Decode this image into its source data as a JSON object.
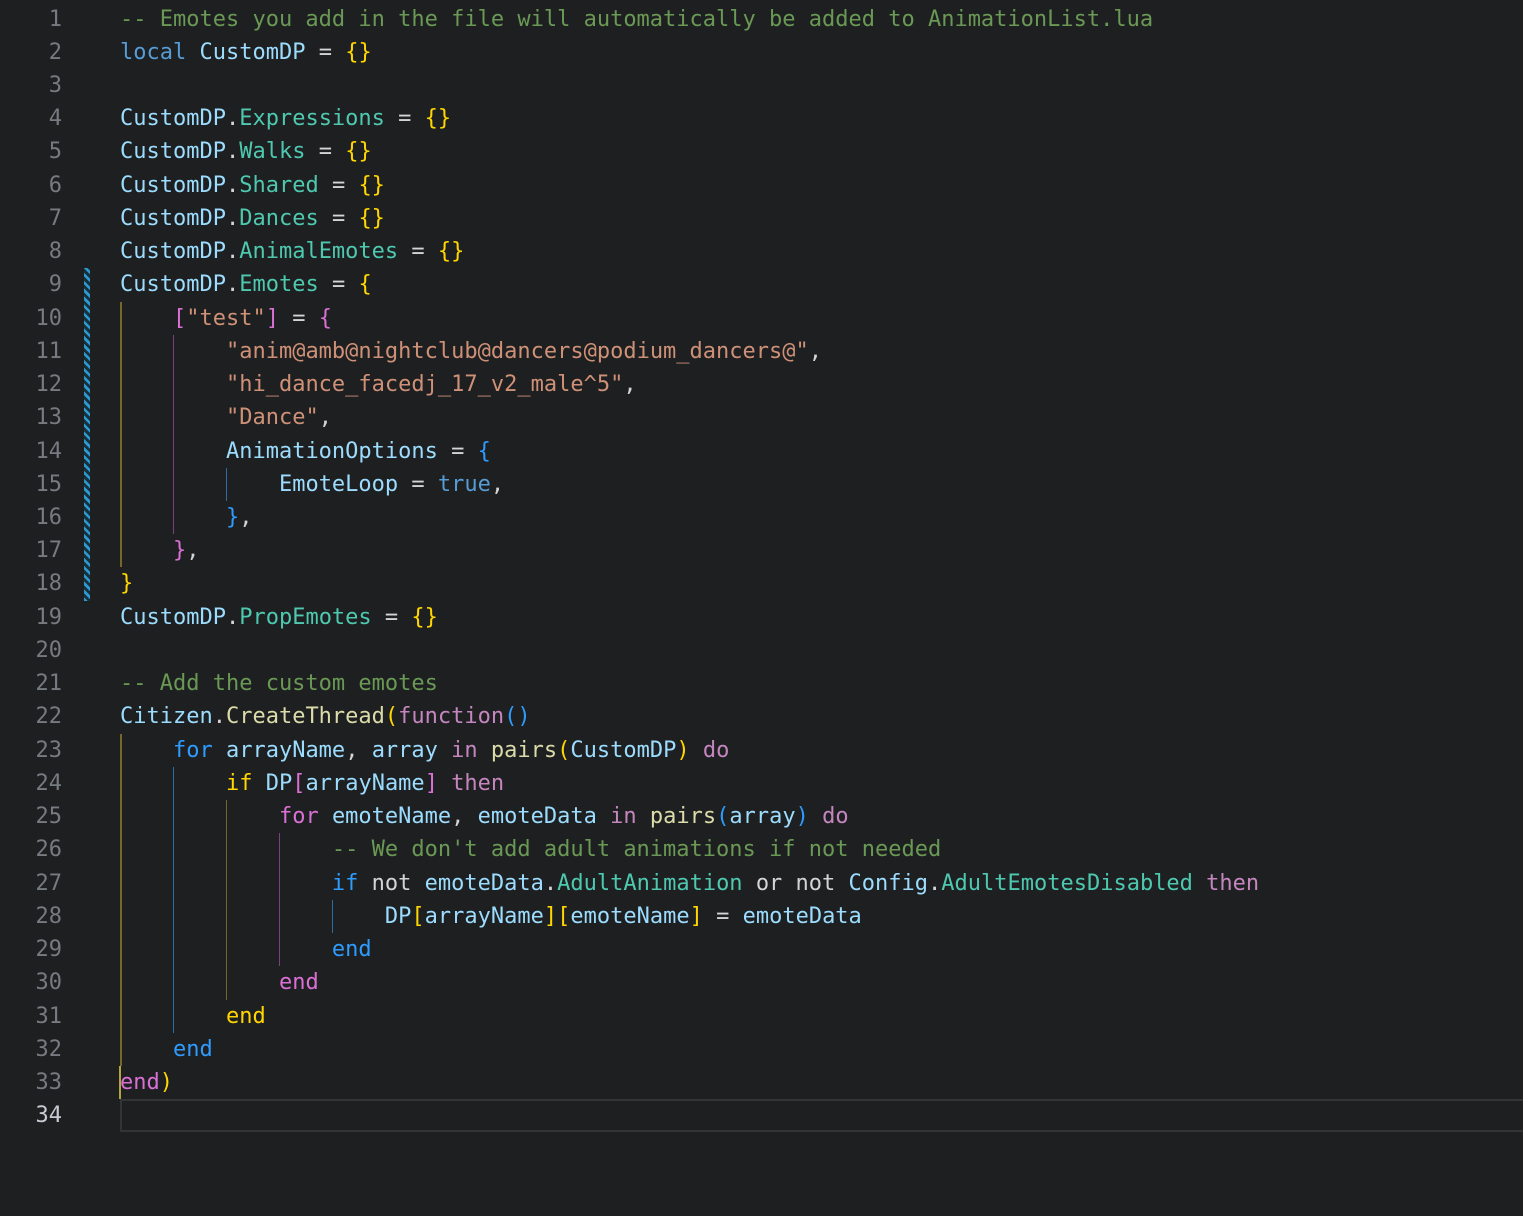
{
  "editor": {
    "title": "AnimationList custom emotes Lua source",
    "language": "lua",
    "background": "#1e1f20",
    "palette": {
      "comment": "#6A9955",
      "keywordBlue": "#569CD6",
      "keywordPink": "#C586C0",
      "variable": "#9CDCFE",
      "property": "#4EC9B0",
      "function": "#DCDCAA",
      "string": "#CE9178",
      "punct": "#D4D4D4",
      "gold": "#FFD602",
      "orchid": "#DA70D6",
      "blue": "#2E9CFF",
      "guideGold": "#77672b",
      "guideOrchid": "#7c4080",
      "guideBlue": "#2c6ca3",
      "lineNumber": "#757b80",
      "lineNumberActive": "#c6ccd2",
      "gitModifiedStripe": "#2e9ad0",
      "caret": "#b3a544",
      "currentLineBorder": "#323536"
    },
    "lines": [
      {
        "n": 1,
        "tokens": [
          [
            "-- Emotes you add in the file will automatically be added to AnimationList.lua",
            "comment"
          ]
        ]
      },
      {
        "n": 2,
        "tokens": [
          [
            "local ",
            "keywordBlue"
          ],
          [
            "CustomDP ",
            "variable"
          ],
          [
            "= ",
            "punct"
          ],
          [
            "{}",
            "gold"
          ]
        ]
      },
      {
        "n": 3,
        "tokens": []
      },
      {
        "n": 4,
        "tokens": [
          [
            "CustomDP",
            "variable"
          ],
          [
            ".",
            "punct"
          ],
          [
            "Expressions ",
            "property"
          ],
          [
            "= ",
            "punct"
          ],
          [
            "{}",
            "gold"
          ]
        ]
      },
      {
        "n": 5,
        "tokens": [
          [
            "CustomDP",
            "variable"
          ],
          [
            ".",
            "punct"
          ],
          [
            "Walks ",
            "property"
          ],
          [
            "= ",
            "punct"
          ],
          [
            "{}",
            "gold"
          ]
        ]
      },
      {
        "n": 6,
        "tokens": [
          [
            "CustomDP",
            "variable"
          ],
          [
            ".",
            "punct"
          ],
          [
            "Shared ",
            "property"
          ],
          [
            "= ",
            "punct"
          ],
          [
            "{}",
            "gold"
          ]
        ]
      },
      {
        "n": 7,
        "tokens": [
          [
            "CustomDP",
            "variable"
          ],
          [
            ".",
            "punct"
          ],
          [
            "Dances ",
            "property"
          ],
          [
            "= ",
            "punct"
          ],
          [
            "{}",
            "gold"
          ]
        ]
      },
      {
        "n": 8,
        "tokens": [
          [
            "CustomDP",
            "variable"
          ],
          [
            ".",
            "punct"
          ],
          [
            "AnimalEmotes ",
            "property"
          ],
          [
            "= ",
            "punct"
          ],
          [
            "{}",
            "gold"
          ]
        ]
      },
      {
        "n": 9,
        "tokens": [
          [
            "CustomDP",
            "variable"
          ],
          [
            ".",
            "punct"
          ],
          [
            "Emotes ",
            "property"
          ],
          [
            "= ",
            "punct"
          ],
          [
            "{",
            "gold"
          ]
        ]
      },
      {
        "n": 10,
        "tokens": [
          [
            "    ",
            "punct"
          ],
          [
            "[",
            "orchid"
          ],
          [
            "\"test\"",
            "string"
          ],
          [
            "] ",
            "orchid"
          ],
          [
            "= ",
            "punct"
          ],
          [
            "{",
            "orchid"
          ]
        ]
      },
      {
        "n": 11,
        "tokens": [
          [
            "        ",
            "punct"
          ],
          [
            "\"anim@amb@nightclub@dancers@podium_dancers@\"",
            "string"
          ],
          [
            ",",
            "punct"
          ]
        ]
      },
      {
        "n": 12,
        "tokens": [
          [
            "        ",
            "punct"
          ],
          [
            "\"hi_dance_facedj_17_v2_male^5\"",
            "string"
          ],
          [
            ",",
            "punct"
          ]
        ]
      },
      {
        "n": 13,
        "tokens": [
          [
            "        ",
            "punct"
          ],
          [
            "\"Dance\"",
            "string"
          ],
          [
            ",",
            "punct"
          ]
        ]
      },
      {
        "n": 14,
        "tokens": [
          [
            "        ",
            "punct"
          ],
          [
            "AnimationOptions ",
            "variable"
          ],
          [
            "= ",
            "punct"
          ],
          [
            "{",
            "blue"
          ]
        ]
      },
      {
        "n": 15,
        "tokens": [
          [
            "            ",
            "punct"
          ],
          [
            "EmoteLoop ",
            "variable"
          ],
          [
            "= ",
            "punct"
          ],
          [
            "true",
            "keywordBlue"
          ],
          [
            ",",
            "punct"
          ]
        ]
      },
      {
        "n": 16,
        "tokens": [
          [
            "        ",
            "punct"
          ],
          [
            "}",
            "blue"
          ],
          [
            ",",
            "punct"
          ]
        ]
      },
      {
        "n": 17,
        "tokens": [
          [
            "    ",
            "punct"
          ],
          [
            "}",
            "orchid"
          ],
          [
            ",",
            "punct"
          ]
        ]
      },
      {
        "n": 18,
        "tokens": [
          [
            "}",
            "gold"
          ]
        ]
      },
      {
        "n": 19,
        "tokens": [
          [
            "CustomDP",
            "variable"
          ],
          [
            ".",
            "punct"
          ],
          [
            "PropEmotes ",
            "property"
          ],
          [
            "= ",
            "punct"
          ],
          [
            "{}",
            "gold"
          ]
        ]
      },
      {
        "n": 20,
        "tokens": []
      },
      {
        "n": 21,
        "tokens": [
          [
            "-- Add the custom emotes",
            "comment"
          ]
        ]
      },
      {
        "n": 22,
        "tokens": [
          [
            "Citizen",
            "variable"
          ],
          [
            ".",
            "punct"
          ],
          [
            "CreateThread",
            "function"
          ],
          [
            "(",
            "gold"
          ],
          [
            "function",
            "keywordPink"
          ],
          [
            "()",
            "blue"
          ]
        ]
      },
      {
        "n": 23,
        "tokens": [
          [
            "    ",
            "punct"
          ],
          [
            "for ",
            "blue"
          ],
          [
            "arrayName",
            "variable"
          ],
          [
            ", ",
            "punct"
          ],
          [
            "array ",
            "variable"
          ],
          [
            "in ",
            "keywordPink"
          ],
          [
            "pairs",
            "function"
          ],
          [
            "(",
            "gold"
          ],
          [
            "CustomDP",
            "variable"
          ],
          [
            ") ",
            "gold"
          ],
          [
            "do",
            "keywordPink"
          ]
        ]
      },
      {
        "n": 24,
        "tokens": [
          [
            "        ",
            "punct"
          ],
          [
            "if ",
            "gold"
          ],
          [
            "DP",
            "variable"
          ],
          [
            "[",
            "orchid"
          ],
          [
            "arrayName",
            "variable"
          ],
          [
            "] ",
            "orchid"
          ],
          [
            "then",
            "keywordPink"
          ]
        ]
      },
      {
        "n": 25,
        "tokens": [
          [
            "            ",
            "punct"
          ],
          [
            "for ",
            "orchid"
          ],
          [
            "emoteName",
            "variable"
          ],
          [
            ", ",
            "punct"
          ],
          [
            "emoteData ",
            "variable"
          ],
          [
            "in ",
            "keywordPink"
          ],
          [
            "pairs",
            "function"
          ],
          [
            "(",
            "blue"
          ],
          [
            "array",
            "variable"
          ],
          [
            ") ",
            "blue"
          ],
          [
            "do",
            "keywordPink"
          ]
        ]
      },
      {
        "n": 26,
        "tokens": [
          [
            "                ",
            "punct"
          ],
          [
            "-- We don't add adult animations if not needed",
            "comment"
          ]
        ]
      },
      {
        "n": 27,
        "tokens": [
          [
            "                ",
            "punct"
          ],
          [
            "if ",
            "blue"
          ],
          [
            "not ",
            "punct"
          ],
          [
            "emoteData",
            "variable"
          ],
          [
            ".",
            "punct"
          ],
          [
            "AdultAnimation ",
            "property"
          ],
          [
            "or not ",
            "punct"
          ],
          [
            "Config",
            "variable"
          ],
          [
            ".",
            "punct"
          ],
          [
            "AdultEmotesDisabled ",
            "property"
          ],
          [
            "then",
            "keywordPink"
          ]
        ]
      },
      {
        "n": 28,
        "tokens": [
          [
            "                    ",
            "punct"
          ],
          [
            "DP",
            "variable"
          ],
          [
            "[",
            "gold"
          ],
          [
            "arrayName",
            "variable"
          ],
          [
            "]",
            "gold"
          ],
          [
            "[",
            "gold"
          ],
          [
            "emoteName",
            "variable"
          ],
          [
            "] ",
            "gold"
          ],
          [
            "= ",
            "punct"
          ],
          [
            "emoteData",
            "variable"
          ]
        ]
      },
      {
        "n": 29,
        "tokens": [
          [
            "                ",
            "punct"
          ],
          [
            "end",
            "blue"
          ]
        ]
      },
      {
        "n": 30,
        "tokens": [
          [
            "            ",
            "punct"
          ],
          [
            "end",
            "orchid"
          ]
        ]
      },
      {
        "n": 31,
        "tokens": [
          [
            "        ",
            "punct"
          ],
          [
            "end",
            "gold"
          ]
        ]
      },
      {
        "n": 32,
        "tokens": [
          [
            "    ",
            "punct"
          ],
          [
            "end",
            "blue"
          ]
        ]
      },
      {
        "n": 33,
        "tokens": [
          [
            "end",
            "orchid"
          ],
          [
            ")",
            "gold"
          ]
        ]
      },
      {
        "n": 34,
        "tokens": []
      }
    ],
    "indent_guides": [
      {
        "col": 0,
        "from": 10,
        "to": 17,
        "color": "guideGold"
      },
      {
        "col": 4,
        "from": 11,
        "to": 16,
        "color": "guideOrchid"
      },
      {
        "col": 8,
        "from": 15,
        "to": 15,
        "color": "guideBlue"
      },
      {
        "col": 0,
        "from": 23,
        "to": 32,
        "color": "guideGold"
      },
      {
        "col": 4,
        "from": 24,
        "to": 31,
        "color": "guideBlue"
      },
      {
        "col": 8,
        "from": 25,
        "to": 30,
        "color": "guideGold"
      },
      {
        "col": 12,
        "from": 26,
        "to": 29,
        "color": "guideOrchid"
      },
      {
        "col": 16,
        "from": 28,
        "to": 28,
        "color": "guideBlue"
      }
    ],
    "gutter": {
      "modified_from_line": 9,
      "modified_to_line": 18
    },
    "cursor": {
      "line": 33,
      "col": 0
    },
    "active_line": 34
  }
}
